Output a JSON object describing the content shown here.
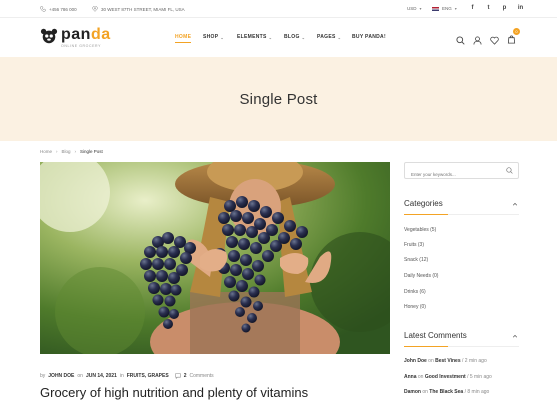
{
  "topbar": {
    "phone": "+456 786 000",
    "address": "30 WEST 87TH STREET, MIAMI FL, USA",
    "currency": "USD",
    "language": "ENG",
    "social": [
      "f",
      "t",
      "p",
      "in"
    ]
  },
  "logo": {
    "part1": "pan",
    "part2": "da",
    "tagline": "ONLINE GROCERY"
  },
  "nav": {
    "home": "HOME",
    "shop": "SHOP",
    "elements": "ELEMENTS",
    "blog": "BLOG",
    "pages": "PAGES",
    "buy": "BUY PANDA!"
  },
  "cart": {
    "count": "0"
  },
  "banner": {
    "title": "Single Post"
  },
  "breadcrumb": {
    "home": "Home",
    "blog": "Blog",
    "current": "Single Post"
  },
  "post": {
    "by": "by",
    "author": "JOHN DOE",
    "on": "on",
    "date": "JUN 14, 2021",
    "in": "in",
    "categories": "FRUITS, GRAPES",
    "comments_count": "2",
    "comments_label": "Comments",
    "title": "Grocery of high nutrition and plenty of vitamins"
  },
  "sidebar": {
    "search_placeholder": "Enter your keywords...",
    "categories_title": "Categories",
    "categories": [
      "Vegetables (5)",
      "Fruits (3)",
      "Snack (12)",
      "Daily Needs (0)",
      "Drinks (6)",
      "Honey (0)"
    ],
    "comments_title": "Latest Comments",
    "comments": [
      {
        "author": "John Doe",
        "on": "on",
        "post": "Best Vines",
        "time": "/ 2 min ago"
      },
      {
        "author": "Anna",
        "on": "on",
        "post": "Good Investment",
        "time": "/ 5 min ago"
      },
      {
        "author": "Damon",
        "on": "on",
        "post": "The Black Sea",
        "time": "/ 8 min ago"
      }
    ]
  },
  "colors": {
    "accent": "#f3a324",
    "banner_bg": "#fbf1e2"
  },
  "icons": [
    "phone-icon",
    "location-icon",
    "search-icon",
    "user-icon",
    "heart-icon",
    "cart-icon",
    "comment-icon",
    "chevron-up-icon"
  ]
}
